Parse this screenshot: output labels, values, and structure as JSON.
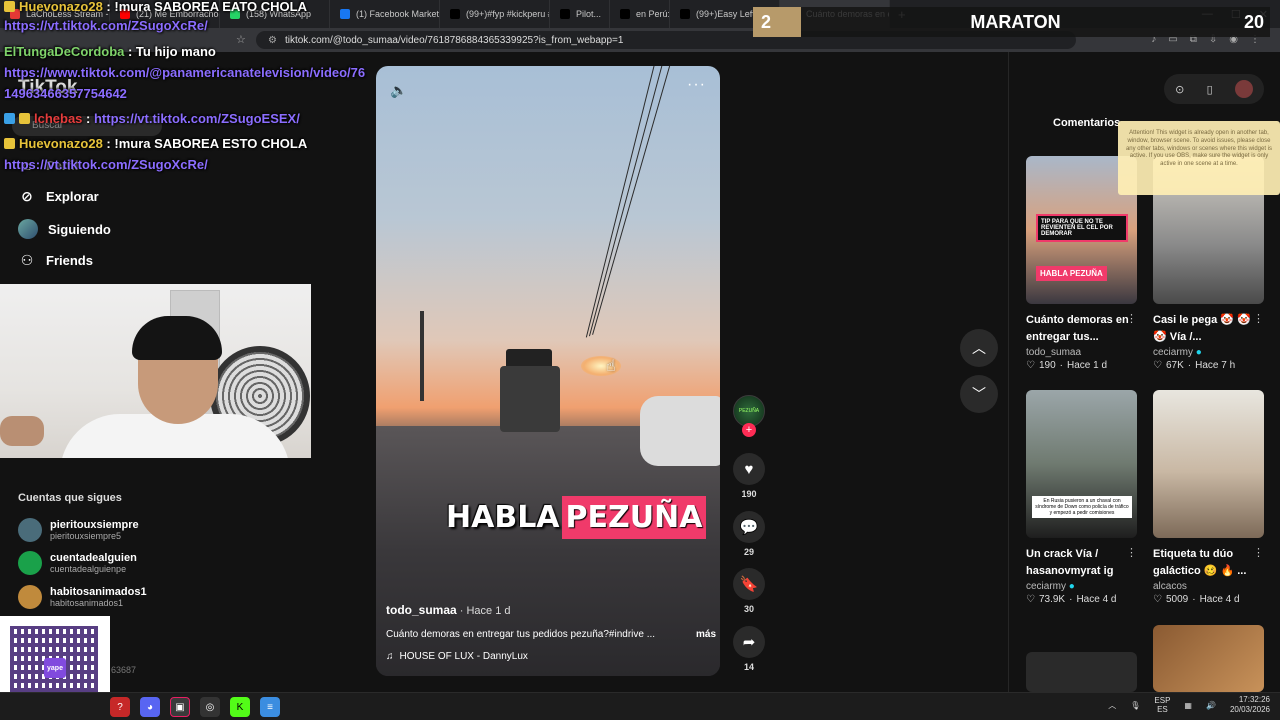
{
  "browser": {
    "tabs": [
      {
        "label": "LaChoLess Stream - Watch Live",
        "color": "#e53935"
      },
      {
        "label": "(21) Me Emborracho por Tu A",
        "color": "#ff0000"
      },
      {
        "label": "(158) WhatsApp",
        "color": "#25d366"
      },
      {
        "label": "(1) Facebook Marketplace | Fa",
        "color": "#1877f2"
      },
      {
        "label": "(99+)#fyp #kickperu #sideral |",
        "color": "#000000"
      },
      {
        "label": "Pilot...",
        "color": "#000000"
      },
      {
        "label": "en Perú: De",
        "color": "#000000"
      },
      {
        "label": "(99+)Easy Leftover Seafood F",
        "color": "#000000"
      },
      {
        "label": "Cuánto demoras en en",
        "color": "#000000"
      }
    ],
    "new_tab": "+",
    "url": "tiktok.com/@todo_sumaa/video/7618786884365339925?is_from_webapp=1"
  },
  "tiktok": {
    "logo": "TikTok",
    "search_placeholder": "Buscar",
    "nav": [
      {
        "label": "Explorar",
        "icon": "compass-icon"
      },
      {
        "label": "Siguiendo",
        "icon": "avatar"
      },
      {
        "label": "Friends",
        "icon": "friends-icon"
      }
    ],
    "following_title": "Cuentas que sigues",
    "following": [
      {
        "name": "pieritouxsiempre",
        "sub": "pieritouxsiempre5",
        "color": "#4a6c7a"
      },
      {
        "name": "cuentadealguien",
        "sub": "cuentadealguienpe",
        "color": "#1aa14a"
      },
      {
        "name": "habitosanimados1",
        "sub": "habitosanimados1",
        "color": "#c08a3c"
      }
    ],
    "partial_nav_label": "Perfil"
  },
  "chat": [
    {
      "user": "Huevonazo28",
      "msg": " : !mura SABOREA EATO CHOLA",
      "user_color": "yellow"
    },
    {
      "link": "https://vt.tiktok.com/ZSugoXcRe/"
    },
    {
      "user": "ElTungaDeCordoba",
      "msg": " : Tu hijo mano",
      "user_color": "green"
    },
    {
      "link": "https://www.tiktok.com/@panamericanatelevision/video/76"
    },
    {
      "link": "14963466357754642"
    },
    {
      "user": "lchebas",
      "msg": " : ",
      "link_inline": "https://vt.tiktok.com/ZSugoESEX/",
      "user_color": "red"
    },
    {
      "user": "Huevonazo28",
      "msg": " : !mura SABOREA ESTO CHOLA",
      "user_color": "yellow"
    },
    {
      "link": "https://vt.tiktok.com/ZSugoXcRe/"
    }
  ],
  "scoreboard": {
    "left": "2",
    "title": "MARATON",
    "right": "20"
  },
  "obs_notice": "Attention! This widget is already open in another tab, window, browser scene. To avoid issues, please close any other tabs, windows or scenes where this widget is active. If you use OBS, make sure the widget is only active in one scene at a time.",
  "qr": {
    "logo": "yape",
    "number": "63687"
  },
  "video": {
    "caption_left": "HABLA",
    "caption_right": "PEZUÑA",
    "author": "todo_sumaa",
    "time": " · Hace 1 d",
    "description": "Cuánto demoras en entregar tus pedidos pezuña?#indrive ...",
    "more": "más",
    "music": "HOUSE OF LUX - DannyLux"
  },
  "actions": {
    "likes": "190",
    "comments": "29",
    "saves": "30",
    "shares": "14"
  },
  "right_panel": {
    "tab": "Comentarios",
    "cards": [
      {
        "title": "Cuánto demoras en entregar tus...",
        "author": "todo_sumaa",
        "likes": "190",
        "time": "Hace 1 d",
        "verified": false,
        "tip": "TIP PARA QUE NO TE REVIENTEN EL CEL POR DEMORAR",
        "cap": "HABLA PEZUÑA"
      },
      {
        "title": "Casi le pega 🤡 🤡 🤡 Vía /...",
        "author": "ceciarmy",
        "likes": "67K",
        "time": "Hace 7 h",
        "verified": true
      },
      {
        "title": "Un crack Vía / hasanovmyrat ig",
        "author": "ceciarmy",
        "likes": "73.9K",
        "time": "Hace 4 d",
        "verified": true,
        "thumb_text": "En Rusia pusieron a un chaval con síndrome de Down como policía de tráfico y empezó a pedir comisiones"
      },
      {
        "title": "Etiqueta tu dúo galáctico 🥴 🔥 ...",
        "author": "alcacos",
        "likes": "5009",
        "time": "Hace 4 d",
        "verified": false
      }
    ]
  },
  "taskbar": {
    "lang_top": "ESP",
    "lang_bottom": "ES",
    "time": "17:32:26",
    "date": "20/03/2026"
  }
}
